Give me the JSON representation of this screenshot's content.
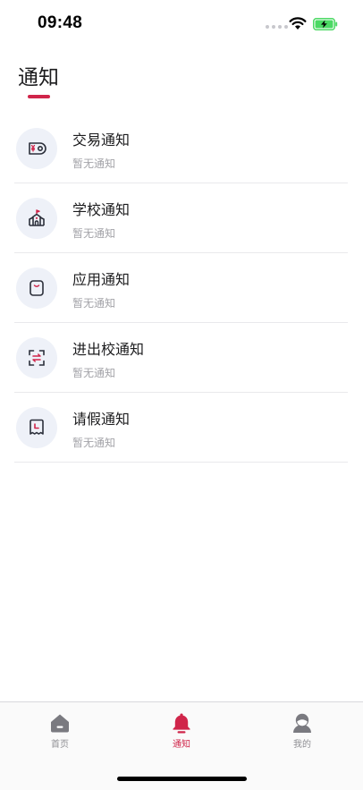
{
  "status_bar": {
    "time": "09:48"
  },
  "header": {
    "title": "通知"
  },
  "notices": [
    {
      "title": "交易通知",
      "subtitle": "暂无通知",
      "icon": "money-bill-icon"
    },
    {
      "title": "学校通知",
      "subtitle": "暂无通知",
      "icon": "school-building-icon"
    },
    {
      "title": "应用通知",
      "subtitle": "暂无通知",
      "icon": "shopping-bag-icon"
    },
    {
      "title": "进出校通知",
      "subtitle": "暂无通知",
      "icon": "scan-transfer-icon"
    },
    {
      "title": "请假通知",
      "subtitle": "暂无通知",
      "icon": "leave-clock-icon"
    }
  ],
  "tabbar": {
    "items": [
      {
        "label": "首页",
        "icon": "home-icon",
        "active": false
      },
      {
        "label": "通知",
        "icon": "bell-icon",
        "active": true
      },
      {
        "label": "我的",
        "icon": "profile-icon",
        "active": false
      }
    ]
  },
  "colors": {
    "accent": "#d0254a",
    "icon_bg": "#eef1f8",
    "icon_stroke": "#2b2f3a",
    "inactive": "#8e8e93"
  }
}
